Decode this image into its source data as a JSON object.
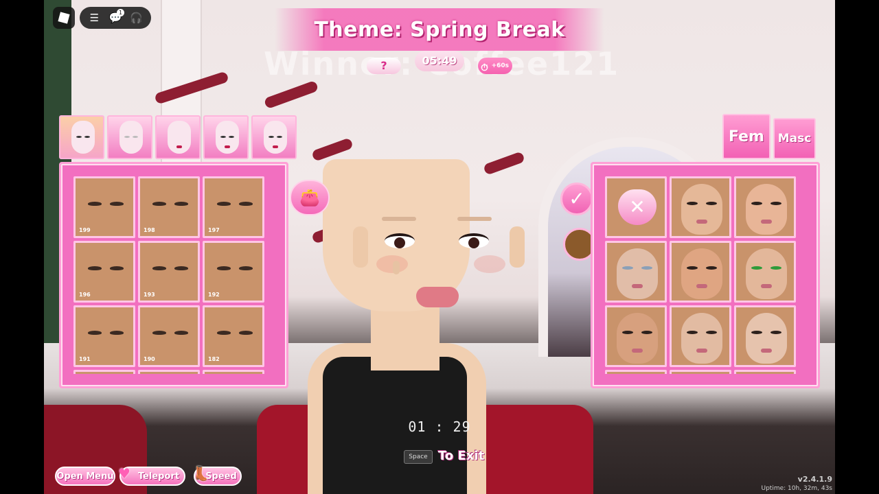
{
  "hud": {
    "theme_title": "Theme: Spring Break",
    "ghost_title": "Winner: Coffee121",
    "round_timer": "05:49",
    "time_boost": "+60s",
    "mystery_label": "?"
  },
  "top_menu": {
    "notification_count": "1"
  },
  "head_tabs": [
    {
      "name": "head-style-1"
    },
    {
      "name": "head-style-2"
    },
    {
      "name": "head-style-3"
    },
    {
      "name": "head-style-4"
    },
    {
      "name": "head-style-5"
    }
  ],
  "left_panel": {
    "items": [
      {
        "id": "199"
      },
      {
        "id": "198"
      },
      {
        "id": "197"
      },
      {
        "id": "196"
      },
      {
        "id": "193"
      },
      {
        "id": "192"
      },
      {
        "id": "191"
      },
      {
        "id": "190"
      },
      {
        "id": "182"
      }
    ]
  },
  "gender_tabs": {
    "fem": "Fem",
    "masc": "Masc"
  },
  "right_panel": {
    "clear_icon": "heart-x-icon",
    "face_count": 8
  },
  "center": {
    "countdown": "01 : 29",
    "key": "Space",
    "exit_label": "To Exit"
  },
  "bottom_bar": {
    "open_menu": "Open Menu",
    "teleport": "Teleport",
    "speed": "Speed"
  },
  "footer": {
    "version": "v2.4.1.9",
    "uptime": "Uptime: 10h, 32m, 43s"
  },
  "colors": {
    "accent_pink": "#f26fc0",
    "panel_border": "#ff9fd6",
    "skin": "#c9936b"
  }
}
